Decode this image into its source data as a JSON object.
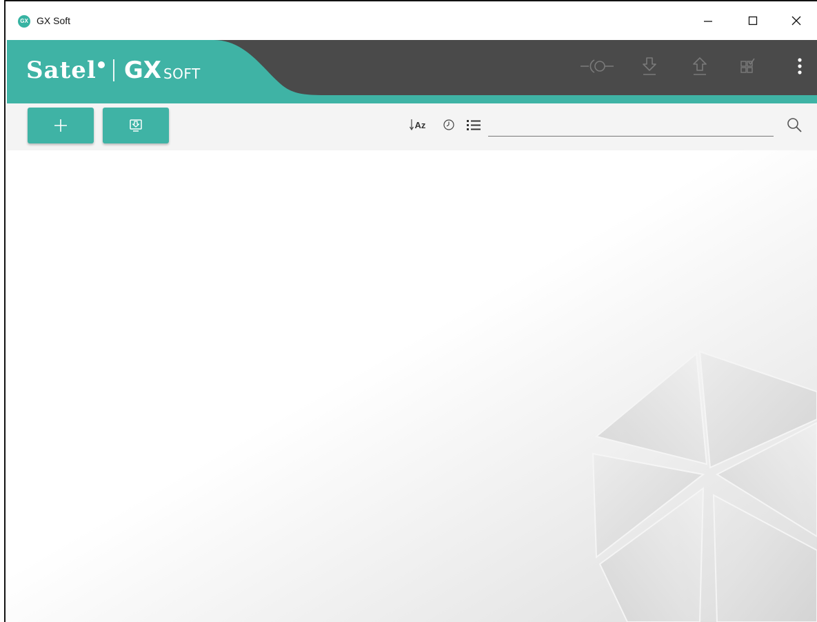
{
  "window": {
    "title": "GX Soft",
    "app_icon_text": "GX"
  },
  "header": {
    "logo_brand": "Satel",
    "logo_product": "GX",
    "logo_product_suffix": "SOFT",
    "icons": [
      "connect-icon",
      "download-icon",
      "upload-icon",
      "modules-icon",
      "more-menu-icon"
    ]
  },
  "toolbar": {
    "add_icon": "plus-icon",
    "import_icon": "import-icon",
    "sort_label": "Az",
    "search": {
      "value": "",
      "placeholder": ""
    }
  },
  "colors": {
    "accent": "#3fb3a5",
    "header_dark": "#4a4a4a",
    "toolbar_bg": "#f4f4f4"
  }
}
